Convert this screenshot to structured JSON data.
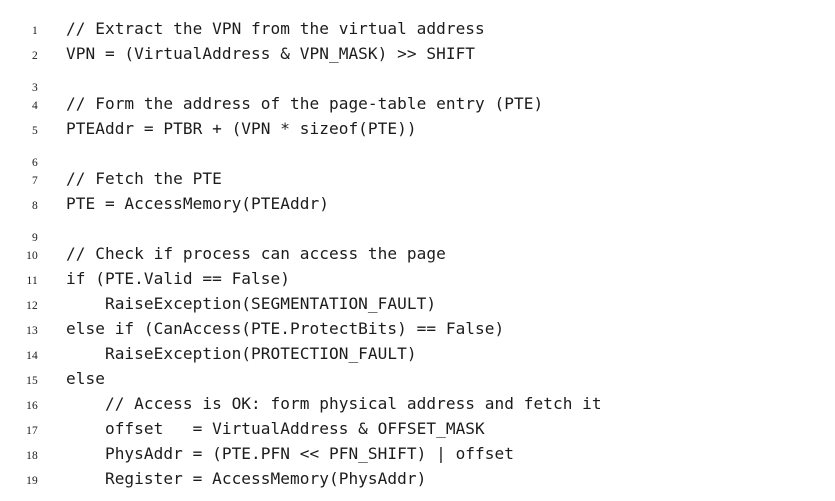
{
  "listing": {
    "type": "code-listing",
    "language": "pseudocode",
    "title": "",
    "font_style": "typewriter-monospace",
    "text_color": "#1c1c1c",
    "background_color": "#ffffff",
    "line_number_color": "#1a1a1a",
    "total_lines": 19,
    "lines": [
      {
        "number": "1",
        "code": "// Extract the VPN from the virtual address"
      },
      {
        "number": "2",
        "code": "VPN = (VirtualAddress & VPN_MASK) >> SHIFT"
      },
      {
        "number": "3",
        "code": ""
      },
      {
        "number": "4",
        "code": "// Form the address of the page-table entry (PTE)"
      },
      {
        "number": "5",
        "code": "PTEAddr = PTBR + (VPN * sizeof(PTE))"
      },
      {
        "number": "6",
        "code": ""
      },
      {
        "number": "7",
        "code": "// Fetch the PTE"
      },
      {
        "number": "8",
        "code": "PTE = AccessMemory(PTEAddr)"
      },
      {
        "number": "9",
        "code": ""
      },
      {
        "number": "10",
        "code": "// Check if process can access the page"
      },
      {
        "number": "11",
        "code": "if (PTE.Valid == False)"
      },
      {
        "number": "12",
        "code": "    RaiseException(SEGMENTATION_FAULT)"
      },
      {
        "number": "13",
        "code": "else if (CanAccess(PTE.ProtectBits) == False)"
      },
      {
        "number": "14",
        "code": "    RaiseException(PROTECTION_FAULT)"
      },
      {
        "number": "15",
        "code": "else"
      },
      {
        "number": "16",
        "code": "    // Access is OK: form physical address and fetch it"
      },
      {
        "number": "17",
        "code": "    offset   = VirtualAddress & OFFSET_MASK"
      },
      {
        "number": "18",
        "code": "    PhysAddr = (PTE.PFN << PFN_SHIFT) | offset"
      },
      {
        "number": "19",
        "code": "    Register = AccessMemory(PhysAddr)"
      }
    ]
  }
}
